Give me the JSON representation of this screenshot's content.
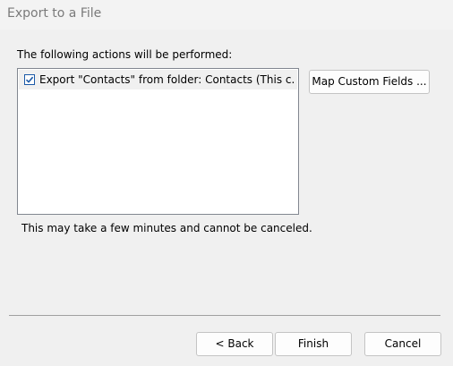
{
  "window": {
    "title": "Export to a File"
  },
  "main": {
    "intro_label": "The following actions will be performed:",
    "actions": [
      {
        "label": "Export \"Contacts\" from folder: Contacts (This c...",
        "checked": true
      }
    ],
    "map_button_label": "Map Custom Fields ...",
    "note": "This may take a few minutes and cannot be canceled."
  },
  "footer": {
    "back_label": "< Back",
    "finish_label": "Finish",
    "cancel_label": "Cancel"
  },
  "colors": {
    "background": "#f0f0f0",
    "title_text": "#7a7a7a",
    "checkbox_accent": "#1c5aa8"
  }
}
